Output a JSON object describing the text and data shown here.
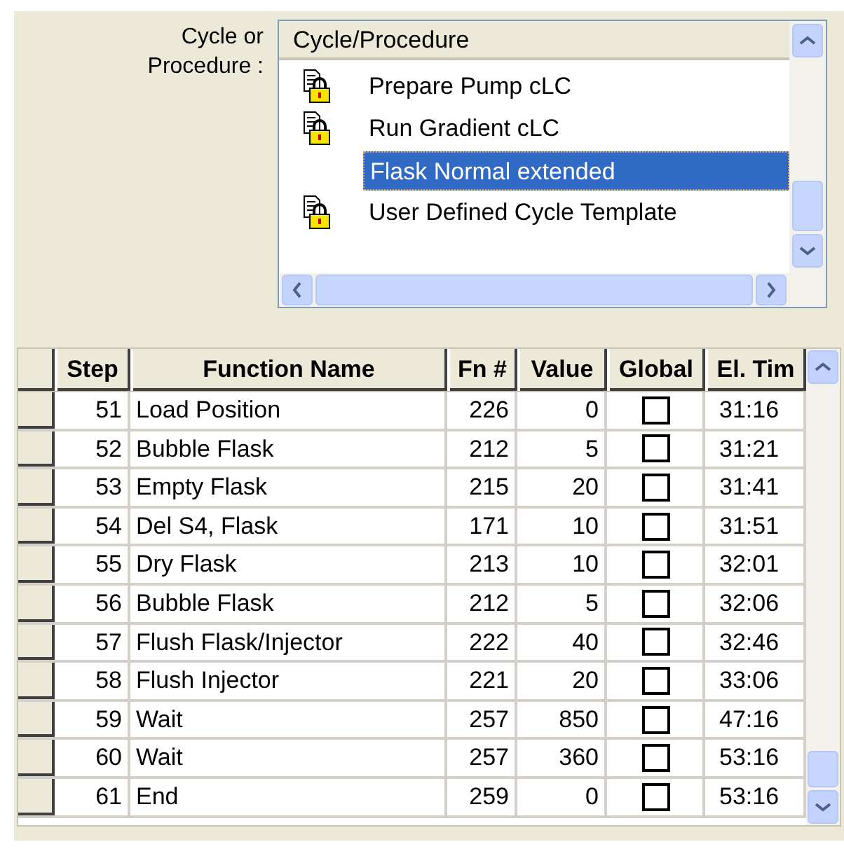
{
  "selector_label": "Cycle or Procedure :",
  "cycle_list": {
    "header": "Cycle/Procedure",
    "items": [
      {
        "label": "Prepare Pump cLC",
        "locked": true,
        "selected": false
      },
      {
        "label": "Run Gradient cLC",
        "locked": true,
        "selected": false
      },
      {
        "label": "Flask Normal extended",
        "locked": false,
        "selected": true
      },
      {
        "label": "User Defined Cycle Template",
        "locked": true,
        "selected": false
      }
    ]
  },
  "table": {
    "columns": [
      "Step",
      "Function Name",
      "Fn #",
      "Value",
      "Global",
      "El. Tim"
    ],
    "rows": [
      {
        "step": "51",
        "function_name": "Load Position",
        "fn": "226",
        "value": "0",
        "global": false,
        "elapsed": "31:16"
      },
      {
        "step": "52",
        "function_name": "Bubble Flask",
        "fn": "212",
        "value": "5",
        "global": false,
        "elapsed": "31:21"
      },
      {
        "step": "53",
        "function_name": "Empty Flask",
        "fn": "215",
        "value": "20",
        "global": false,
        "elapsed": "31:41"
      },
      {
        "step": "54",
        "function_name": "Del S4, Flask",
        "fn": "171",
        "value": "10",
        "global": false,
        "elapsed": "31:51"
      },
      {
        "step": "55",
        "function_name": "Dry Flask",
        "fn": "213",
        "value": "10",
        "global": false,
        "elapsed": "32:01"
      },
      {
        "step": "56",
        "function_name": "Bubble Flask",
        "fn": "212",
        "value": "5",
        "global": false,
        "elapsed": "32:06"
      },
      {
        "step": "57",
        "function_name": "Flush Flask/Injector",
        "fn": "222",
        "value": "40",
        "global": false,
        "elapsed": "32:46"
      },
      {
        "step": "58",
        "function_name": "Flush Injector",
        "fn": "221",
        "value": "20",
        "global": false,
        "elapsed": "33:06"
      },
      {
        "step": "59",
        "function_name": "Wait",
        "fn": "257",
        "value": "850",
        "global": false,
        "elapsed": "47:16"
      },
      {
        "step": "60",
        "function_name": "Wait",
        "fn": "257",
        "value": "360",
        "global": false,
        "elapsed": "53:16"
      },
      {
        "step": "61",
        "function_name": "End",
        "fn": "259",
        "value": "0",
        "global": false,
        "elapsed": "53:16"
      }
    ]
  }
}
